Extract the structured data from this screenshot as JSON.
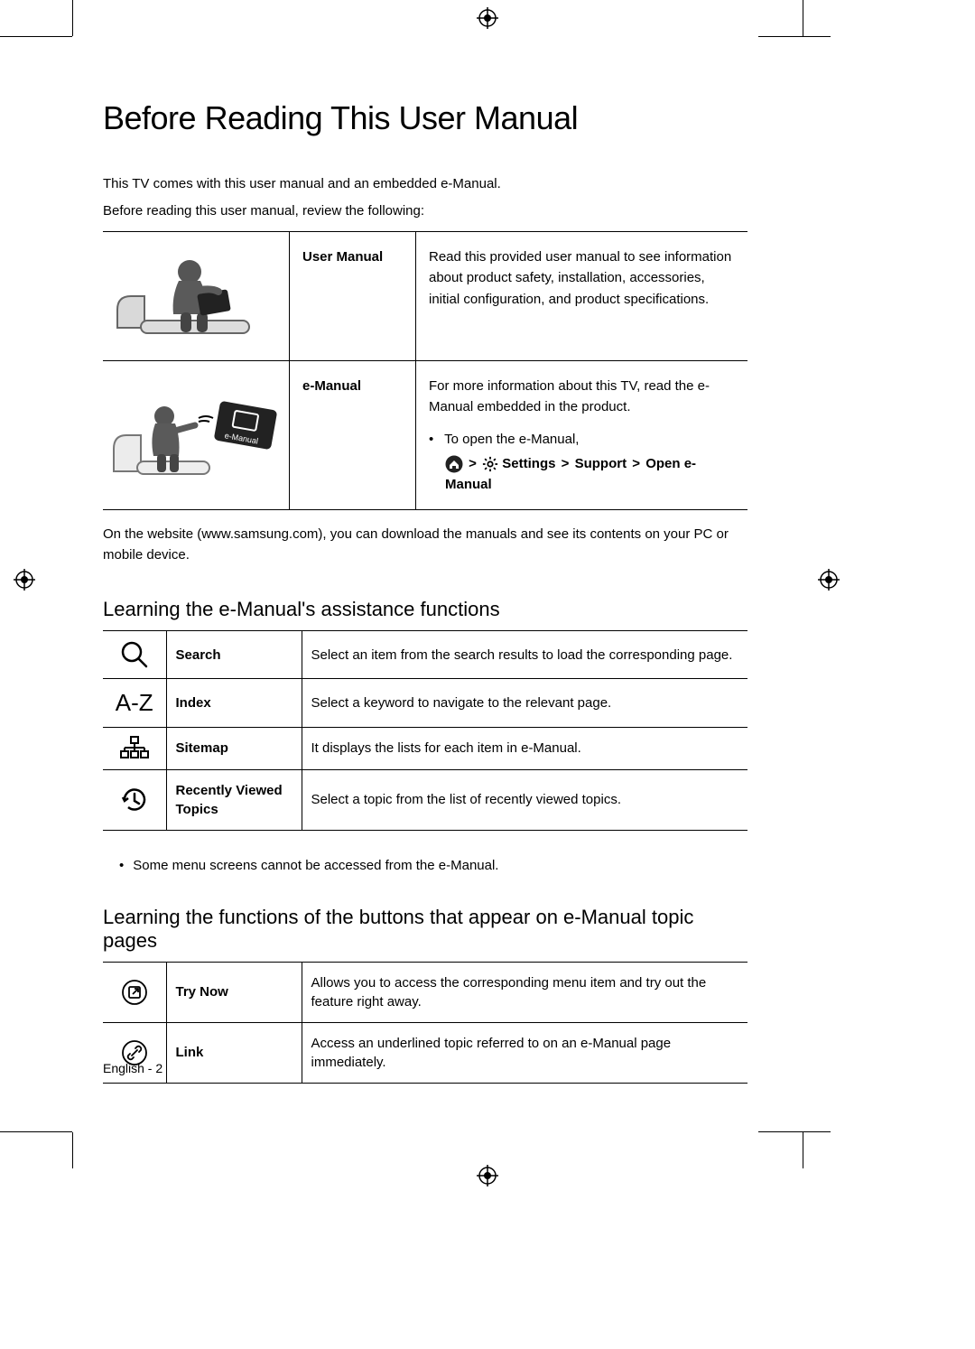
{
  "title": "Before Reading This User Manual",
  "intro1": "This TV comes with this user manual and an embedded e-Manual.",
  "intro2": "Before reading this user manual, review the following:",
  "manuals": {
    "user_manual": {
      "name": "User Manual",
      "desc": "Read this provided user manual to see information about product safety, installation, accessories, initial configuration, and product specifications."
    },
    "e_manual": {
      "name": "e-Manual",
      "desc": "For more information about this TV, read the e-Manual embedded in the product.",
      "open_label": "To open the e-Manual,",
      "path": {
        "p1": "Settings",
        "p2": "Support",
        "p3": "Open e-Manual"
      }
    }
  },
  "website_note": "On the website (www.samsung.com), you can download the manuals and see its contents on your PC or mobile device.",
  "section2_title": "Learning the e-Manual's assistance functions",
  "fn": {
    "search": {
      "name": "Search",
      "desc": "Select an item from the search results to load the corresponding page."
    },
    "index": {
      "name": "Index",
      "desc": "Select a keyword to navigate to the relevant page.",
      "icon_text": "A-Z"
    },
    "sitemap": {
      "name": "Sitemap",
      "desc": "It displays the lists for each item in e-Manual."
    },
    "recent": {
      "name": "Recently Viewed Topics",
      "desc": "Select a topic from the list of recently viewed topics."
    }
  },
  "note1": "Some menu screens cannot be accessed from the e-Manual.",
  "section3_title": "Learning the functions of the buttons that appear on e-Manual topic pages",
  "btn": {
    "trynow": {
      "name": "Try Now",
      "desc": "Allows you to access the corresponding menu item and try out the feature right away."
    },
    "link": {
      "name": "Link",
      "desc": "Access an underlined topic referred to on an e-Manual page immediately."
    }
  },
  "footer": "English - 2"
}
